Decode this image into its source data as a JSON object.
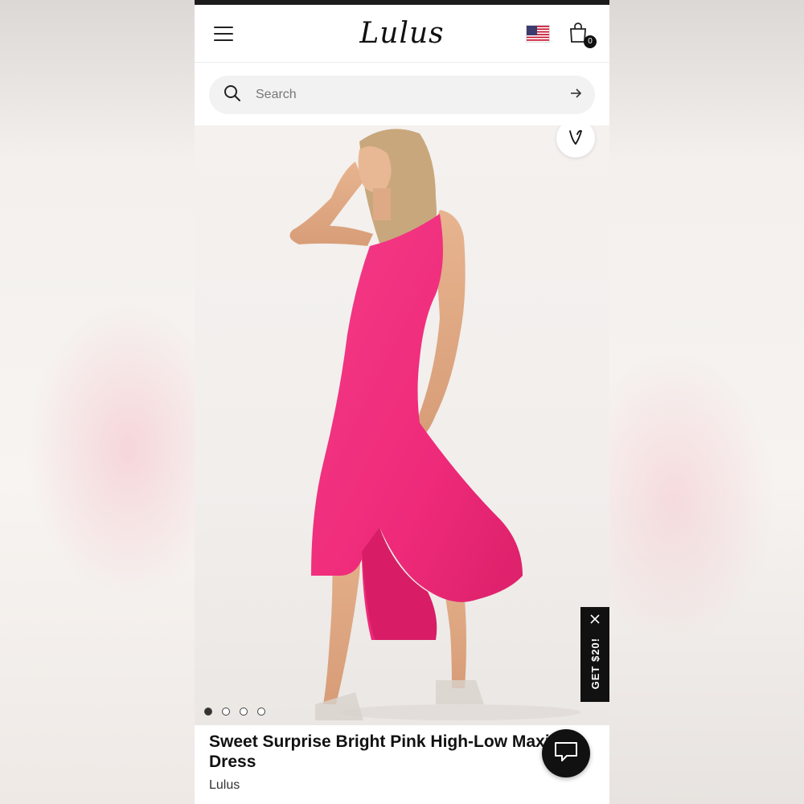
{
  "header": {
    "logo_text": "Lulus",
    "cart_count": "0"
  },
  "search": {
    "placeholder": "Search"
  },
  "product": {
    "title": "Sweet Surprise Bright Pink High-Low Maxi Dress",
    "brand": "Lulus",
    "image_count": 4,
    "active_image_index": 0,
    "dress_color": "#f0287a"
  },
  "promo": {
    "label": "GET $20!"
  },
  "icons": {
    "menu": "hamburger-icon",
    "flag": "us-flag-icon",
    "bag": "shopping-bag-icon",
    "search": "search-icon",
    "submit": "arrow-right-icon",
    "wishlist": "heart-icon",
    "close": "close-icon",
    "chat": "chat-icon"
  }
}
